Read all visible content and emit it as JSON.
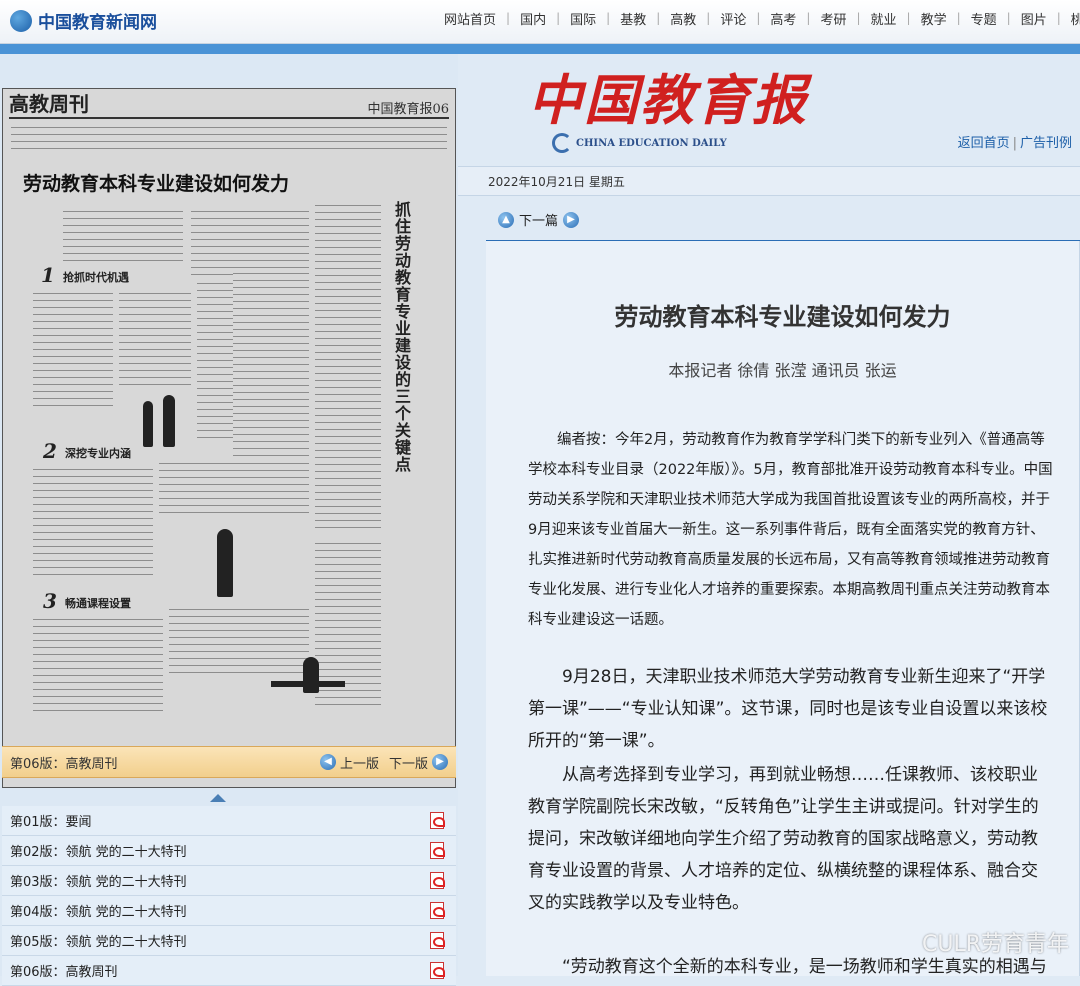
{
  "site": {
    "logo_text": "中国教育新闻网"
  },
  "nav": [
    "网站首页",
    "国内",
    "国际",
    "基教",
    "高教",
    "评论",
    "高考",
    "考研",
    "就业",
    "教学",
    "专题",
    "图片",
    "桃"
  ],
  "paper": {
    "section": "高教周刊",
    "page_tag": "中国教育报06",
    "title": "劳动教育本科专业建设如何发力",
    "vertical_title": "抓住劳动教育专业建设的三个关键点",
    "sub1": "抢抓时代机遇",
    "sub2": "深挖专业内涵",
    "sub3": "畅通课程设置"
  },
  "issue_bar": {
    "current": "第06版：高教周刊",
    "prev": "上一版",
    "next": "下一版"
  },
  "pages": [
    "第01版：要闻",
    "第02版：领航 党的二十大特刊",
    "第03版：领航 党的二十大特刊",
    "第04版：领航 党的二十大特刊",
    "第05版：领航 党的二十大特刊",
    "第06版：高教周刊"
  ],
  "masthead": {
    "title": "中国教育报",
    "english": "CHINA EDUCATION DAILY"
  },
  "links": {
    "home": "返回首页",
    "ads": "广告刊例"
  },
  "date": "2022年10月21日  星期五",
  "next_article": "下一篇",
  "article": {
    "title": "劳动教育本科专业建设如何发力",
    "byline": "本报记者 徐倩 张滢 通讯员 张运",
    "editor_note": "编者按：今年2月，劳动教育作为教育学学科门类下的新专业列入《普通高等学校本科专业目录（2022年版）》。5月，教育部批准开设劳动教育本科专业。中国劳动关系学院和天津职业技术师范大学成为我国首批设置该专业的两所高校，并于9月迎来该专业首届大一新生。这一系列事件背后，既有全面落实党的教育方针、扎实推进新时代劳动教育高质量发展的长远布局，又有高等教育领域推进劳动教育专业化发展、进行专业化人才培养的重要探索。本期高教周刊重点关注劳动教育本科专业建设这一话题。",
    "p1": "9月28日，天津职业技术师范大学劳动教育专业新生迎来了“开学第一课”——“专业认知课”。这节课，同时也是该专业自设置以来该校所开的“第一课”。",
    "p2": "从高考选择到专业学习，再到就业畅想……任课教师、该校职业教育学院副院长宋改敏，“反转角色”让学生主讲或提问。针对学生的提问，宋改敏详细地向学生介绍了劳动教育的国家战略意义，劳动教育专业设置的背景、人才培养的定位、纵横统整的课程体系、融合交叉的实践教学以及专业特色。",
    "p3": "“劳动教育这个全新的本科专业，是一场教师和学生真实的相遇与探索，以真实的情感投入教学，以真实的应用改造激活……"
  },
  "watermark": "CULR劳育青年"
}
